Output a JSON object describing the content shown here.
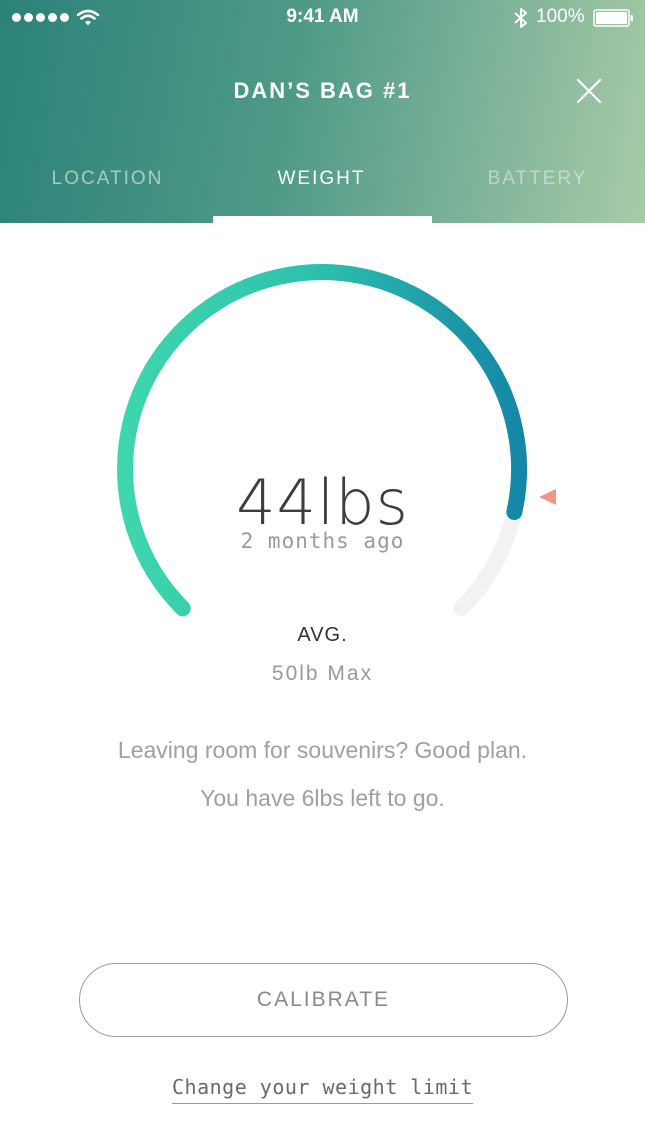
{
  "status_bar": {
    "time": "9:41 AM",
    "battery_percent": "100%",
    "signal_bars": 5,
    "icons": [
      "signal-dots-icon",
      "wifi-icon",
      "bluetooth-icon",
      "battery-icon"
    ]
  },
  "header": {
    "title": "DAN’S BAG #1",
    "close_icon": "close-icon"
  },
  "tabs": [
    {
      "label": "LOCATION",
      "active": false
    },
    {
      "label": "WEIGHT",
      "active": true
    },
    {
      "label": "BATTERY",
      "active": false
    }
  ],
  "gauge": {
    "reading": "44lbs",
    "reading_time": "2 months ago",
    "avg_label": "AVG.",
    "max_label": "50lb Max",
    "value_lbs": 44,
    "max_lbs": 50,
    "avg_marker_icon": "triangle-marker-icon",
    "colors": {
      "arc_start": "#3dd6ad",
      "arc_end": "#1487a6",
      "track": "#f2f2f2",
      "marker": "#f4948a"
    }
  },
  "message": {
    "line1": "Leaving room for souvenirs? Good plan.",
    "line2": "You have 6lbs left to go."
  },
  "actions": {
    "calibrate_label": "CALIBRATE",
    "change_limit_label": "Change your weight limit"
  }
}
